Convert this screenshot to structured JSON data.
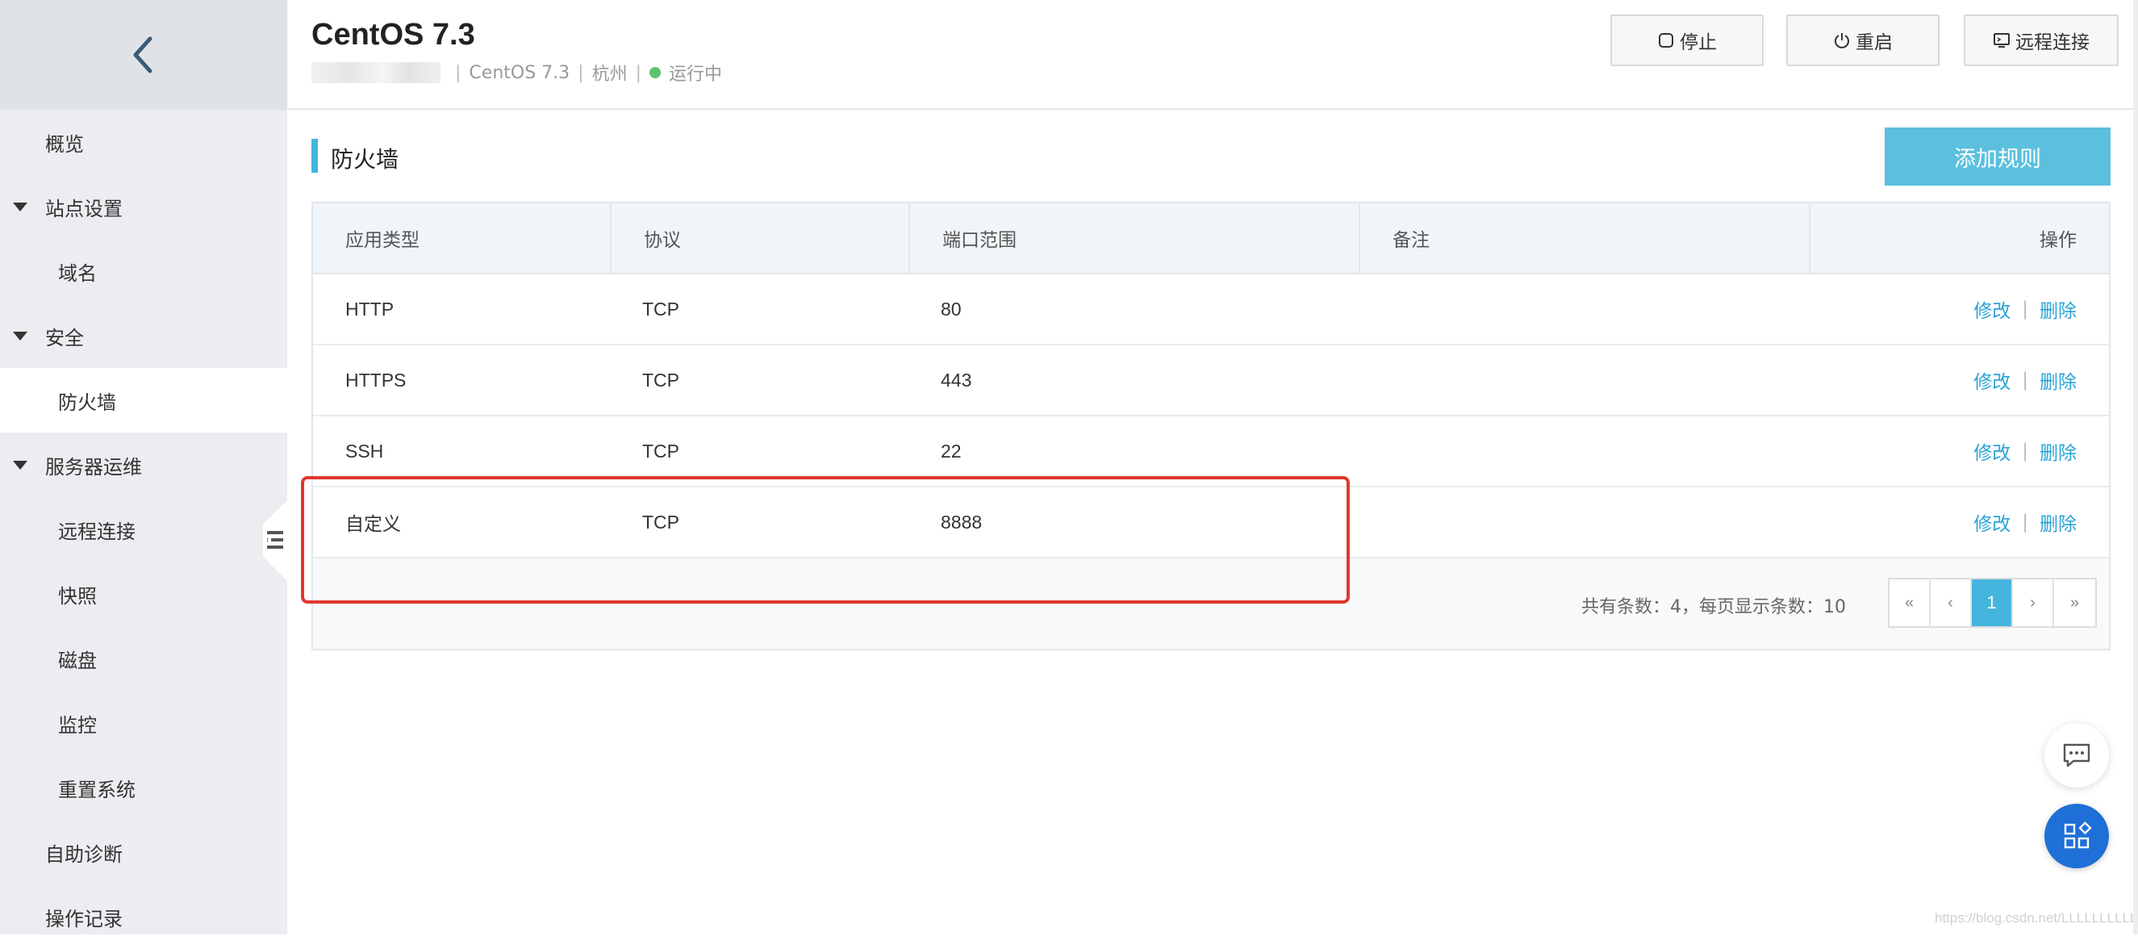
{
  "sidebar": {
    "back_icon": "chevron-left-icon",
    "items": [
      {
        "label": "概览"
      },
      {
        "label": "站点设置"
      },
      {
        "label": "域名"
      },
      {
        "label": "安全"
      },
      {
        "label": "防火墙"
      },
      {
        "label": "服务器运维"
      },
      {
        "label": "远程连接"
      },
      {
        "label": "快照"
      },
      {
        "label": "磁盘"
      },
      {
        "label": "监控"
      },
      {
        "label": "重置系统"
      },
      {
        "label": "自助诊断"
      },
      {
        "label": "操作记录"
      }
    ],
    "active_item": "防火墙"
  },
  "header": {
    "title": "CentOS 7.3",
    "meta": {
      "os": "CentOS 7.3",
      "region": "杭州",
      "status": "运行中",
      "status_color": "#5cc36d"
    },
    "buttons": {
      "stop": "停止",
      "restart": "重启",
      "remote": "远程连接"
    }
  },
  "section": {
    "title": "防火墙",
    "add_button": "添加规则"
  },
  "table": {
    "columns": [
      "应用类型",
      "协议",
      "端口范围",
      "备注",
      "操作"
    ],
    "rows": [
      {
        "app": "HTTP",
        "protocol": "TCP",
        "port": "80",
        "note": "",
        "edit": "修改",
        "delete": "删除"
      },
      {
        "app": "HTTPS",
        "protocol": "TCP",
        "port": "443",
        "note": "",
        "edit": "修改",
        "delete": "删除"
      },
      {
        "app": "SSH",
        "protocol": "TCP",
        "port": "22",
        "note": "",
        "edit": "修改",
        "delete": "删除"
      },
      {
        "app": "自定义",
        "protocol": "TCP",
        "port": "8888",
        "note": "",
        "edit": "修改",
        "delete": "删除"
      }
    ],
    "action_separator": "|"
  },
  "pagination": {
    "summary": "共有条数：4，每页显示条数：10",
    "first": "«",
    "prev": "‹",
    "current": "1",
    "next": "›",
    "last": "»"
  },
  "colors": {
    "accent": "#44b5dc",
    "link": "#2aa3d6",
    "highlight": "#e0382e",
    "fab": "#1e6fd6"
  },
  "floating": {
    "chat_icon": "chat-icon",
    "apps_icon": "apps-icon"
  },
  "watermark": "https://blog.csdn.net/LLLLLLLLLLL"
}
